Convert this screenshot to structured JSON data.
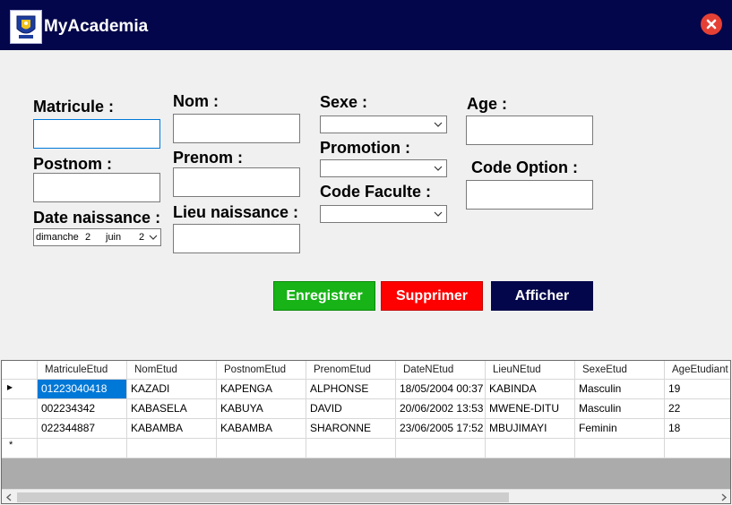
{
  "window": {
    "title": "MyAcademia",
    "logo_icon": "university-crest-icon",
    "close_icon": "close-icon"
  },
  "form": {
    "matricule_label": "Matricule :",
    "matricule_value": "",
    "postnom_label": "Postnom :",
    "postnom_value": "",
    "date_label": "Date naissance :",
    "date_day_name": "dimanche",
    "date_day": "2",
    "date_month": "juin",
    "date_year": "2",
    "nom_label": "Nom :",
    "nom_value": "",
    "prenom_label": "Prenom :",
    "prenom_value": "",
    "lieu_label": "Lieu naissance :",
    "lieu_value": "",
    "sexe_label": "Sexe :",
    "sexe_value": "",
    "promotion_label": "Promotion :",
    "promotion_value": "",
    "faculte_label": "Code Faculte :",
    "faculte_value": "",
    "age_label": "Age :",
    "age_value": "",
    "option_label": "Code Option :",
    "option_value": ""
  },
  "buttons": {
    "save": {
      "label": "Enregistrer",
      "color": "#17b317"
    },
    "delete": {
      "label": "Supprimer",
      "color": "#ff0000"
    },
    "show": {
      "label": "Afficher",
      "color": "#03064a"
    }
  },
  "grid": {
    "columns": [
      "MatriculeEtud",
      "NomEtud",
      "PostnomEtud",
      "PrenomEtud",
      "DateNEtud",
      "LieuNEtud",
      "SexeEtud",
      "AgeEtudiant"
    ],
    "rows": [
      [
        "01223040418",
        "KAZADI",
        "KAPENGA",
        "ALPHONSE",
        "18/05/2004 00:37",
        "KABINDA",
        "Masculin",
        "19"
      ],
      [
        "002234342",
        "KABASELA",
        "KABUYA",
        "DAVID",
        "20/06/2002 13:53",
        "MWENE-DITU",
        "Masculin",
        "22"
      ],
      [
        "022344887",
        "KABAMBA",
        "KABAMBA",
        "SHARONNE",
        "23/06/2005 17:52",
        "MBUJIMAYI",
        "Feminin",
        "18"
      ]
    ],
    "current_row_marker": "▸",
    "new_row_marker": "*"
  },
  "colors": {
    "titlebar": "#03064a",
    "selection": "#0078d7",
    "close": "#e64035"
  }
}
